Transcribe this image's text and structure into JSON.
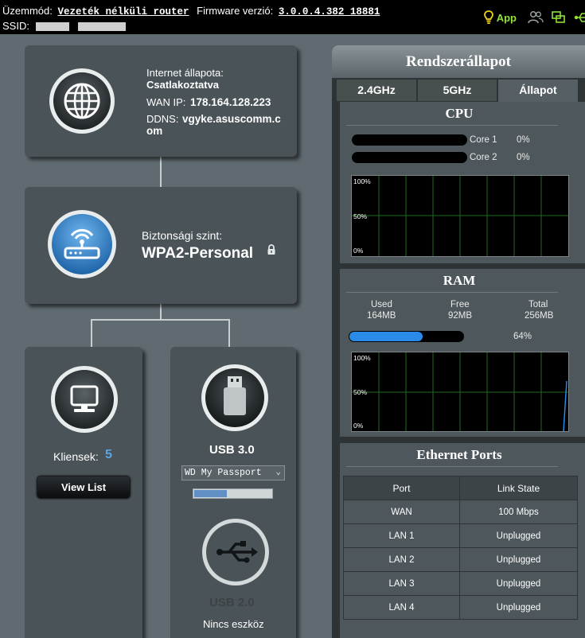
{
  "topbar": {
    "mode_label": "Üzemmód:",
    "mode_value": "Vezeték nélküli router",
    "firmware_label": "Firmware verzió:",
    "firmware_value": "3.0.0.4.382_18881",
    "ssid_label": "SSID:",
    "app_label": "App"
  },
  "internet": {
    "status_label": "Internet állapota:",
    "status_value": "Csatlakoztatva",
    "wan_ip_label": "WAN IP:",
    "wan_ip_value": "178.164.128.223",
    "ddns_label": "DDNS:",
    "ddns_value_line1": "vgyke.asuscomm.c",
    "ddns_value_line2": "om",
    "icon": "globe-icon"
  },
  "security": {
    "label": "Biztonsági szint:",
    "value": "WPA2-Personal",
    "icon": "router-icon",
    "lock_icon": "lock-icon"
  },
  "clients": {
    "label": "Kliensek:",
    "count": "5",
    "button": "View List",
    "icon": "monitor-icon"
  },
  "usb3": {
    "label": "USB 3.0",
    "device": "WD My Passport",
    "usage_fraction": 0.42,
    "icon": "usb-drive-icon"
  },
  "usb2": {
    "label": "USB 2.0",
    "status": "Nincs eszköz",
    "icon": "usb-symbol-icon"
  },
  "system": {
    "title": "Rendszerállapot",
    "tabs": [
      "2.4GHz",
      "5GHz",
      "Állapot"
    ],
    "active_tab": "Állapot",
    "cpu": {
      "title": "CPU",
      "cores": [
        {
          "name": "Core 1",
          "percent": "0%"
        },
        {
          "name": "Core 2",
          "percent": "0%"
        }
      ],
      "graph_labels": [
        "100%",
        "50%",
        "0%"
      ]
    },
    "ram": {
      "title": "RAM",
      "used_label": "Used",
      "used_value": "164MB",
      "free_label": "Free",
      "free_value": "92MB",
      "total_label": "Total",
      "total_value": "256MB",
      "percent": "64%",
      "usage_fraction": 0.64,
      "graph_labels": [
        "100%",
        "50%",
        "0%"
      ]
    },
    "ethernet": {
      "title": "Ethernet Ports",
      "columns": [
        "Port",
        "Link State"
      ],
      "rows": [
        [
          "WAN",
          "100 Mbps"
        ],
        [
          "LAN 1",
          "Unplugged"
        ],
        [
          "LAN 2",
          "Unplugged"
        ],
        [
          "LAN 3",
          "Unplugged"
        ],
        [
          "LAN 4",
          "Unplugged"
        ]
      ]
    }
  },
  "colors": {
    "accent_blue": "#2a8ae8",
    "app_green": "#8fe23a",
    "background": "#5f6b70"
  }
}
